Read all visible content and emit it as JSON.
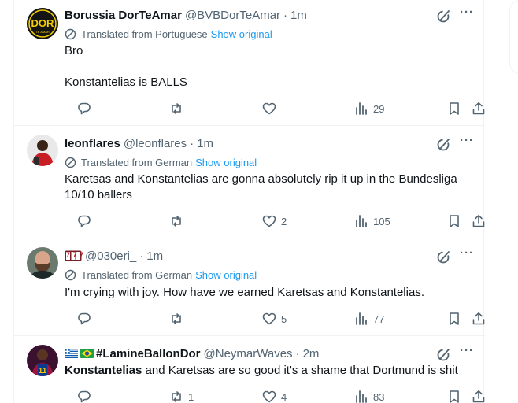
{
  "tweets": [
    {
      "name": "Borussia DorTeAmar",
      "handle": "@BVBDorTeAmar",
      "time": "1m",
      "translated_from": "Translated from Portuguese",
      "show_original": "Show original",
      "lines": [
        "Bro",
        "Konstantelias is BALLS"
      ],
      "avatar_text": "DOR",
      "avatar_subtext": "TE AMAR",
      "replies": "",
      "retweets": "",
      "likes": "",
      "views": "29"
    },
    {
      "name": "leonflares",
      "handle": "@leonflares",
      "time": "1m",
      "translated_from": "Translated from German",
      "show_original": "Show original",
      "lines": [
        "Karetsas and Konstantelias are gonna absolutely rip it up in the Bundesliga",
        "10/10 ballers"
      ],
      "replies": "",
      "retweets": "",
      "likes": "2",
      "views": "105"
    },
    {
      "name_emoji": "777",
      "handle": "@030eri_",
      "time": "1m",
      "translated_from": "Translated from German",
      "show_original": "Show original",
      "lines": [
        "I'm crying with joy. How have we earned Karetsas and Konstantelias."
      ],
      "replies": "",
      "retweets": "",
      "likes": "5",
      "views": "77"
    },
    {
      "name": "#LamineBallonDor",
      "handle": "@NeymarWaves",
      "time": "2m",
      "text_bold": "Konstantelias",
      "text_rest": " and Karetsas are so good it's a shame that Dortmund is shit",
      "avatar_number": "11",
      "replies": "",
      "retweets": "1",
      "likes": "4",
      "views": "83"
    }
  ],
  "colors": {
    "accent": "#1d9bf0",
    "muted": "#536471",
    "text": "#0f1419",
    "border": "#eff3f4"
  }
}
